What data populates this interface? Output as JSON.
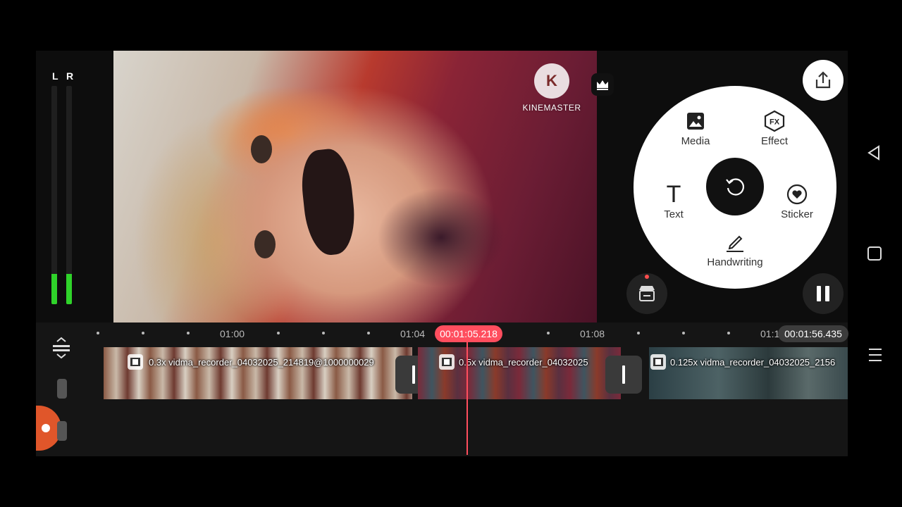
{
  "meter": {
    "left_label": "L",
    "right_label": "R",
    "level_left": 0.14,
    "level_right": 0.14
  },
  "preview": {
    "watermark_letter": "K",
    "watermark_text": "KINEMASTER"
  },
  "actions": {
    "export_icon": "share-icon",
    "wheel": {
      "media": "Media",
      "effect": "Effect",
      "effect_badge": "FX",
      "text": "Text",
      "text_glyph": "T",
      "sticker": "Sticker",
      "handwriting": "Handwriting",
      "center_icon": "undo-icon"
    },
    "store_icon": "store-icon",
    "pause_icon": "pause-icon"
  },
  "timeline": {
    "tick_labels": [
      "01:00",
      "01:04",
      "01:08",
      "01:1"
    ],
    "current_time": "00:01:05.218",
    "total_time": "00:01:56.435",
    "clips": [
      {
        "name": "0.3x vidma_recorder_04032025_214819@1000000029"
      },
      {
        "name": "0.5x vidma_recorder_04032025"
      },
      {
        "name": "0.125x vidma_recorder_04032025_2156"
      }
    ]
  },
  "colors": {
    "accent": "#ff4e5e",
    "meter_green": "#2fd32a",
    "record_orange": "#e0562a"
  }
}
